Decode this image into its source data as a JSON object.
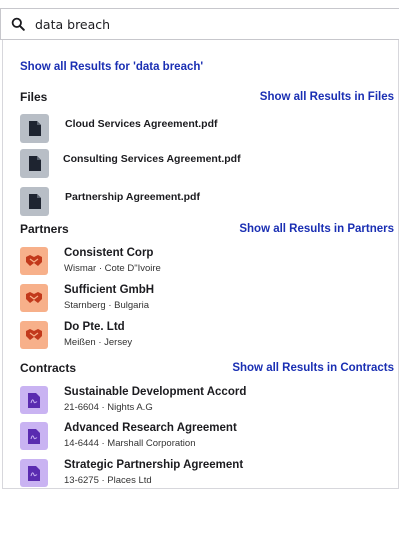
{
  "search": {
    "value": "data breach"
  },
  "show_all_results": "Show all Results for 'data breach'",
  "files": {
    "title": "Files",
    "link": "Show all Results in Files",
    "items": [
      {
        "name": "Cloud Services Agreement.pdf"
      },
      {
        "name": "Consulting Services Agreement.pdf"
      },
      {
        "name": "Partnership Agreement.pdf"
      }
    ]
  },
  "partners": {
    "title": "Partners",
    "link": "Show all Results in Partners",
    "items": [
      {
        "name": "Consistent Corp",
        "location": "Wismar · Cote D\"Ivoire"
      },
      {
        "name": "Sufficient GmbH",
        "location": "Starnberg · Bulgaria"
      },
      {
        "name": "Do Pte. Ltd",
        "location": "Meißen · Jersey"
      }
    ]
  },
  "contracts": {
    "title": "Contracts",
    "link": "Show all Results in Contracts",
    "items": [
      {
        "name": "Sustainable Development Accord",
        "detail": "21-6604 · Nights A.G"
      },
      {
        "name": "Advanced Research Agreement",
        "detail": "14-6444 · Marshall Corporation"
      },
      {
        "name": "Strategic Partnership Agreement",
        "detail": "13-6275 · Places Ltd"
      }
    ]
  },
  "colors": {
    "link": "#1a2fb3",
    "file_icon_bg": "#b8bec6",
    "partner_icon_bg": "#f7b08a",
    "partner_icon_fg": "#c2391b",
    "contract_icon_bg": "#c9b3f2",
    "contract_icon_fg": "#5a2bb0"
  },
  "icons": {
    "search": "search-icon",
    "file": "document-icon",
    "partner": "handshake-icon",
    "contract": "contract-document-icon"
  }
}
